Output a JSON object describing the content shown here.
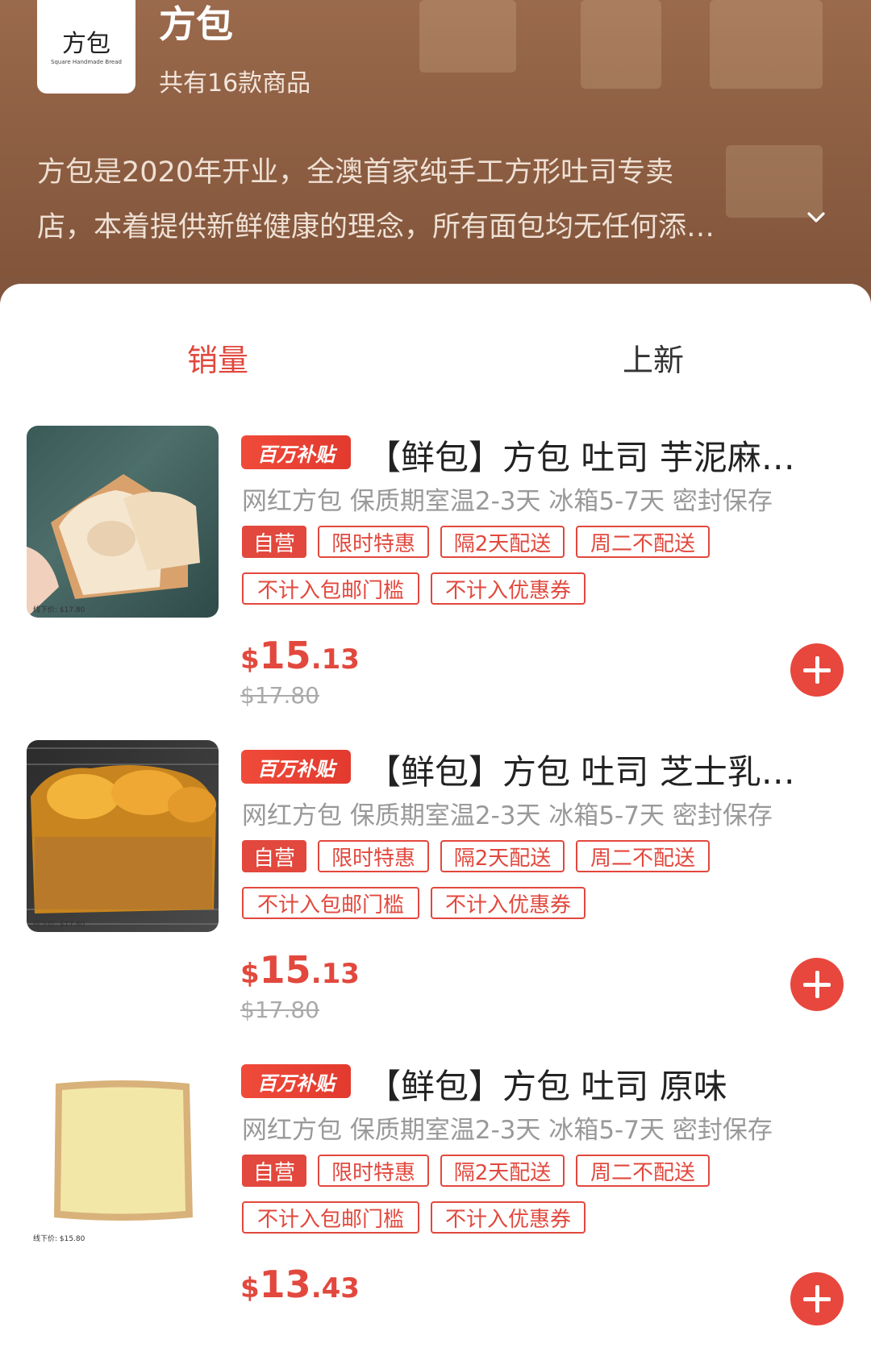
{
  "shop": {
    "logo_text": "方包",
    "logo_sub": "Square Handmade Bread",
    "name": "方包",
    "count": "共有16款商品",
    "desc_line1": "方包是2020年开业，全澳首家纯手工方形吐司专卖",
    "desc_line2": "店，本着提供新鲜健康的理念，所有面包均无任何添…"
  },
  "tabs": {
    "sales": "销量",
    "new": "上新"
  },
  "colors": {
    "accent": "#e2483d",
    "header_bg": "#8d5e42"
  },
  "products": [
    {
      "badge": "百万补贴",
      "title": "【鲜包】方包 吐司 芋泥麻…",
      "subtitle": "网红方包 保质期室温2-3天 冰箱5-7天 密封保存",
      "tags": [
        "自营",
        "限时特惠",
        "隔2天配送",
        "周二不配送",
        "不计入包邮门槛",
        "不计入优惠券"
      ],
      "price_currency": "$",
      "price_int": "15",
      "price_dec": ".13",
      "orig_price": "$17.80",
      "thumb_caption": "线下价: $17.80"
    },
    {
      "badge": "百万补贴",
      "title": "【鲜包】方包 吐司 芝士乳…",
      "subtitle": "网红方包 保质期室温2-3天 冰箱5-7天 密封保存",
      "tags": [
        "自营",
        "限时特惠",
        "隔2天配送",
        "周二不配送",
        "不计入包邮门槛",
        "不计入优惠券"
      ],
      "price_currency": "$",
      "price_int": "15",
      "price_dec": ".13",
      "orig_price": "$17.80",
      "thumb_caption": "线下价: $17.80"
    },
    {
      "badge": "百万补贴",
      "title": "【鲜包】方包 吐司 原味",
      "subtitle": "网红方包 保质期室温2-3天 冰箱5-7天 密封保存",
      "tags": [
        "自营",
        "限时特惠",
        "隔2天配送",
        "周二不配送",
        "不计入包邮门槛",
        "不计入优惠券"
      ],
      "price_currency": "$",
      "price_int": "13",
      "price_dec": ".43",
      "orig_price": "",
      "thumb_caption": "线下价: $15.80"
    }
  ]
}
